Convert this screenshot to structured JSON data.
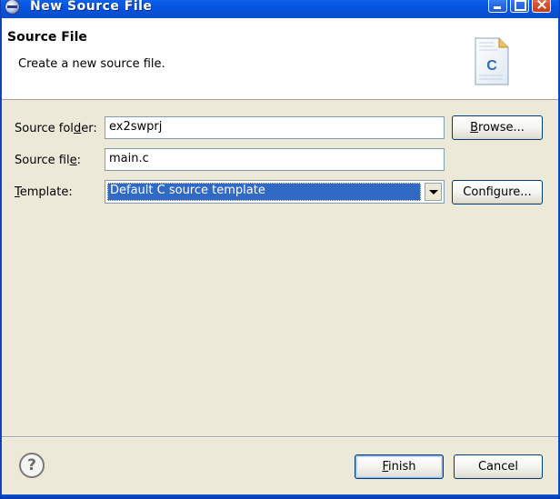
{
  "window": {
    "title": "New Source File"
  },
  "header": {
    "title": "Source File",
    "description": "Create a new source file.",
    "icon_letter": "C"
  },
  "form": {
    "source_folder": {
      "label_pre": "Source fol",
      "label_mnemonic": "d",
      "label_post": "er:",
      "value": "ex2swprj"
    },
    "source_file": {
      "label_pre": "Source fil",
      "label_mnemonic": "e",
      "label_post": ":",
      "value": "main.c"
    },
    "template": {
      "label_mnemonic": "T",
      "label_post": "emplate:",
      "selected": "Default C source template"
    }
  },
  "buttons": {
    "browse_mnemonic": "B",
    "browse_rest": "rowse...",
    "configure": "Configure...",
    "finish_mnemonic": "F",
    "finish_rest": "inish",
    "cancel": "Cancel",
    "help": "?"
  },
  "colors": {
    "title_bar": "#0a5ee8",
    "selection": "#316ac5",
    "dialog_bg": "#ece9d8"
  }
}
